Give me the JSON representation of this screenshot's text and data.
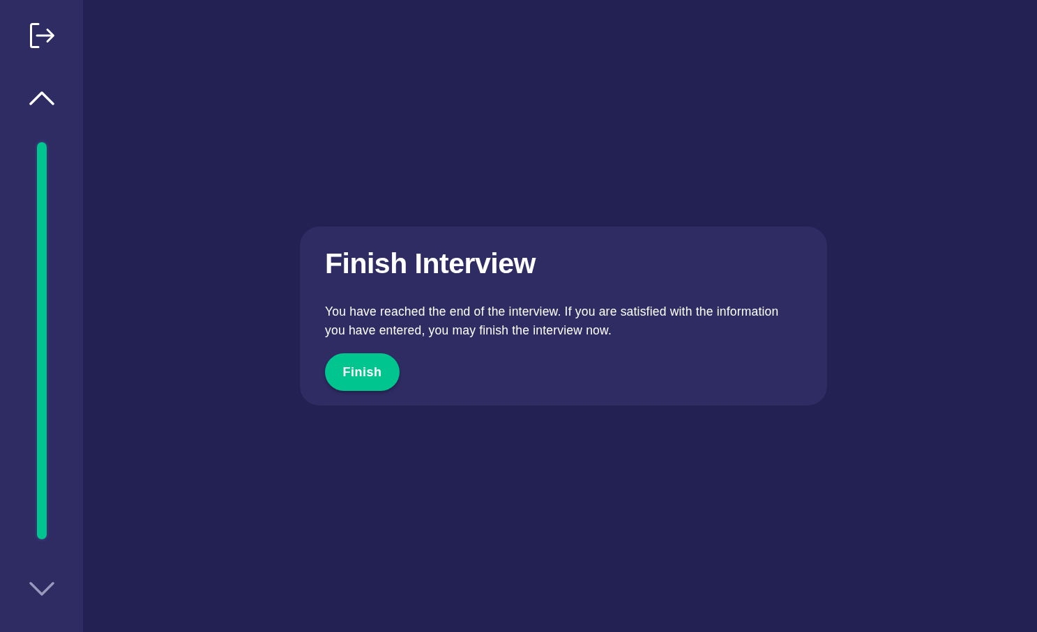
{
  "sidebar": {
    "scroll_up": {
      "disabled": false
    },
    "progress": {
      "level": 1
    },
    "scroll_down": {
      "disabled": true
    }
  },
  "card": {
    "title": "Finish Interview",
    "text": "You have reached the end of the interview. If you are satisfied with the information you have entered, you may finish the interview now.",
    "button": "Finish"
  }
}
